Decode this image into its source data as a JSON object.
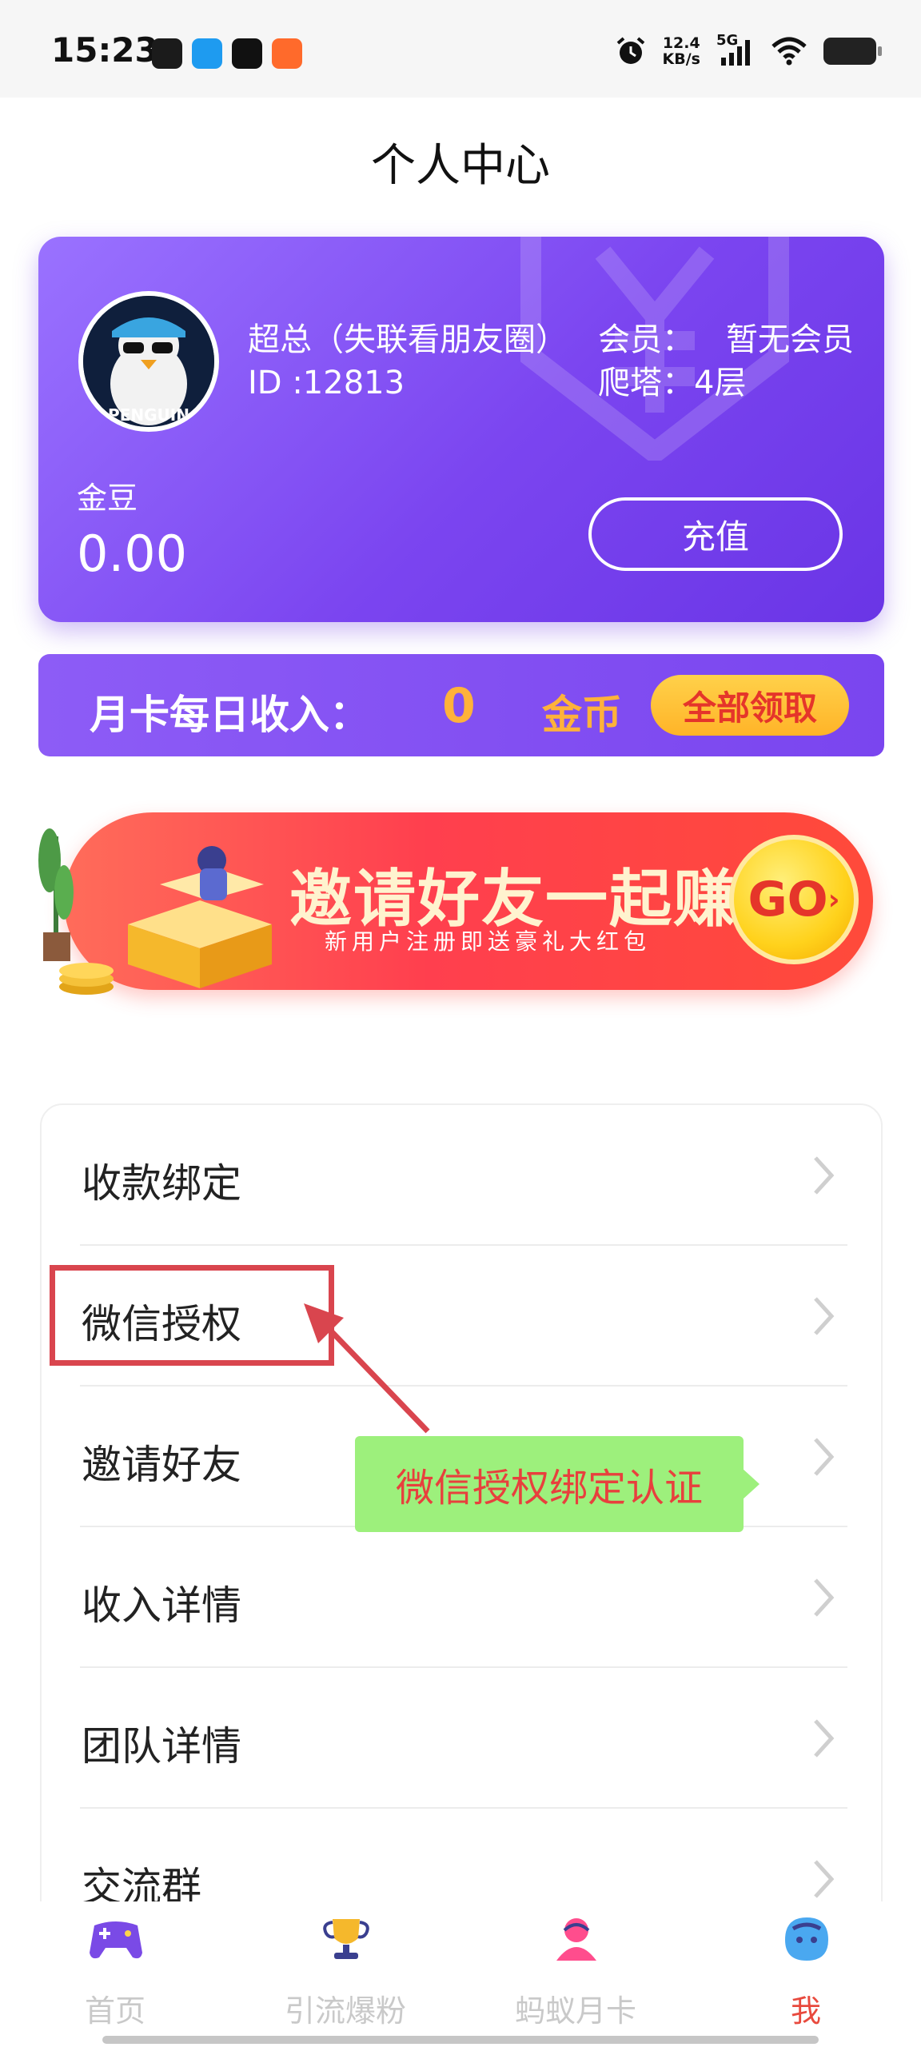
{
  "status_bar": {
    "time": "15:23",
    "net_speed_value": "12.4",
    "net_speed_unit": "KB/s",
    "network_type": "5G",
    "apps": [
      "qq-icon",
      "qq-browser-icon",
      "tiktok-icon",
      "taobao-icon"
    ]
  },
  "header": {
    "title": "个人中心"
  },
  "profile": {
    "nickname": "超总（失联看朋友圈）",
    "id_text": "ID :12813",
    "member_label": "会员：",
    "member_value": "暂无会员",
    "tower_label": "爬塔：",
    "tower_value": "4层",
    "gold_label": "金豆",
    "gold_value": "0.00",
    "recharge_label": "充值",
    "avatar_text": "PENGUIN"
  },
  "monthly_income": {
    "label": "月卡每日收入：",
    "value": "0",
    "unit": "金币",
    "claim_label": "全部领取"
  },
  "invite_banner": {
    "title": "邀请好友一起赚钱",
    "subtitle": "新用户注册即送豪礼大红包",
    "go_label": "GO"
  },
  "menu": {
    "items": [
      {
        "label": "收款绑定"
      },
      {
        "label": "微信授权"
      },
      {
        "label": "邀请好友"
      },
      {
        "label": "收入详情"
      },
      {
        "label": "团队详情"
      },
      {
        "label": "交流群"
      }
    ]
  },
  "annotation": {
    "tooltip_text": "微信授权绑定认证",
    "highlight_color": "#d9454e",
    "tooltip_bg": "#9df07c"
  },
  "bottom_nav": {
    "items": [
      {
        "label": "首页",
        "icon": "gamepad-icon"
      },
      {
        "label": "引流爆粉",
        "icon": "trophy-icon"
      },
      {
        "label": "蚂蚁月卡",
        "icon": "person-icon"
      },
      {
        "label": "我",
        "icon": "face-icon"
      }
    ],
    "active_index": 3,
    "active_color": "#e84a3e"
  },
  "colors": {
    "card_purple": "#7b45f0",
    "gold": "#ffb23a",
    "banner_red": "#ff3f4e"
  }
}
